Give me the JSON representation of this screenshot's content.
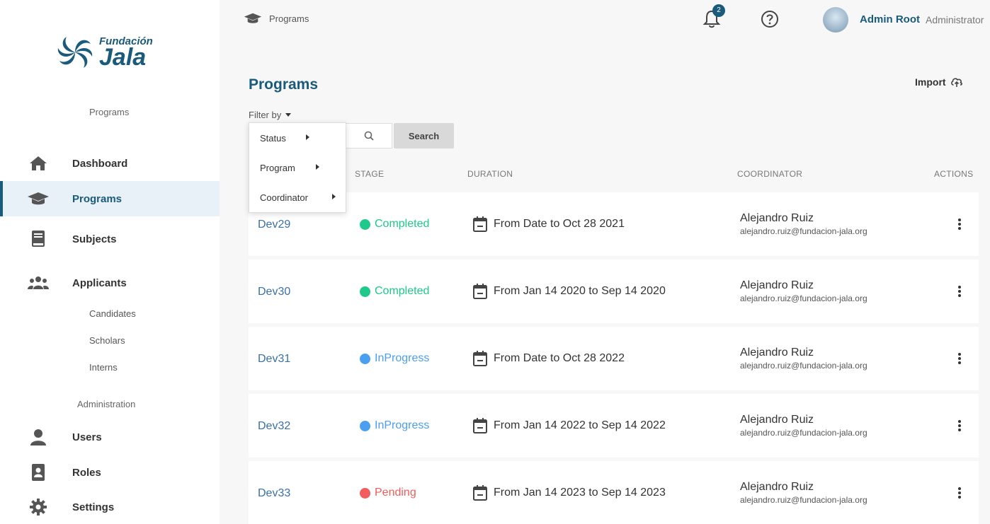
{
  "brand": {
    "line1": "Fundación",
    "line2": "Jala"
  },
  "sidebar": {
    "section_programs": "Programs",
    "items": [
      {
        "label": "Dashboard",
        "icon": "home-icon"
      },
      {
        "label": "Programs",
        "icon": "graduation-cap-icon",
        "active": true
      },
      {
        "label": "Subjects",
        "icon": "book-icon"
      },
      {
        "label": "Applicants",
        "icon": "group-icon"
      }
    ],
    "applicant_subitems": [
      "Candidates",
      "Scholars",
      "Interns"
    ],
    "section_admin": "Administration",
    "admin_items": [
      {
        "label": "Users",
        "icon": "user-icon"
      },
      {
        "label": "Roles",
        "icon": "id-badge-icon"
      },
      {
        "label": "Settings",
        "icon": "gear-icon"
      }
    ]
  },
  "topbar": {
    "breadcrumb": "Programs",
    "notifications_count": "2",
    "user_name": "Admin Root",
    "user_role": "Administrator"
  },
  "main": {
    "title": "Programs",
    "import_label": "Import",
    "filter_label": "Filter by",
    "search_label": "Search",
    "filter_menu": [
      "Status",
      "Program",
      "Coordinator"
    ],
    "columns": {
      "stage": "STAGE",
      "duration": "DURATION",
      "coordinator": "COORDINATOR",
      "actions": "ACTIONS"
    },
    "rows": [
      {
        "code": "Dev29",
        "stage": "Completed",
        "stage_color": "#1ec98a",
        "duration": "From Date to Oct 28 2021",
        "coordinator": "Alejandro Ruiz",
        "email": "alejandro.ruiz@fundacion-jala.org"
      },
      {
        "code": "Dev30",
        "stage": "Completed",
        "stage_color": "#1ec98a",
        "duration": "From Jan 14 2020 to Sep 14 2020",
        "coordinator": "Alejandro Ruiz",
        "email": "alejandro.ruiz@fundacion-jala.org"
      },
      {
        "code": "Dev31",
        "stage": "InProgress",
        "stage_color": "#4a9ff0",
        "duration": "From Date to Oct 28 2022",
        "coordinator": "Alejandro Ruiz",
        "email": "alejandro.ruiz@fundacion-jala.org"
      },
      {
        "code": "Dev32",
        "stage": "InProgress",
        "stage_color": "#4a9ff0",
        "duration": "From Jan 14 2022 to Sep 14 2022",
        "coordinator": "Alejandro Ruiz",
        "email": "alejandro.ruiz@fundacion-jala.org"
      },
      {
        "code": "Dev33",
        "stage": "Pending",
        "stage_color": "#f25c5c",
        "duration": "From Jan 14 2023 to Sep 14 2023",
        "coordinator": "Alejandro Ruiz",
        "email": "alejandro.ruiz@fundacion-jala.org"
      }
    ]
  },
  "colors": {
    "brand": "#1a5a7a",
    "link": "#3a6fa8",
    "active_bg": "#e8f0f8"
  }
}
